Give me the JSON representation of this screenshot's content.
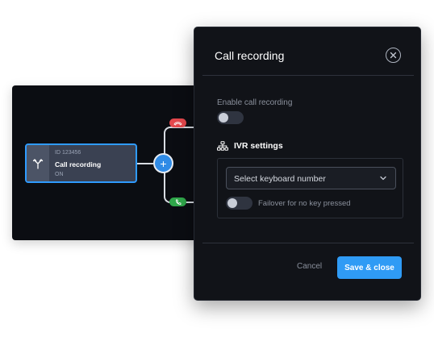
{
  "node": {
    "id_text": "ID 123456",
    "title": "Call recording",
    "status": "ON",
    "icon": "branch-split-icon"
  },
  "connectors": {
    "add_symbol": "+",
    "top_pill_icon": "hangup-phone-icon",
    "top_pill_color": "#e5484d",
    "bottom_pill_icon": "phone-icon",
    "bottom_pill_color": "#30a84b"
  },
  "modal": {
    "title": "Call recording",
    "enable_label": "Enable call recording",
    "enable_on": false,
    "ivr": {
      "heading": "IVR  settings",
      "icon": "sitemap-icon",
      "select_placeholder": "Select  keyboard number",
      "failover_label": "Failover for no key pressed",
      "failover_on": false
    },
    "cancel_label": "Cancel",
    "save_label": "Save & close"
  },
  "colors": {
    "accent": "#2f9bf5",
    "node_border": "#2f9bff",
    "canvas_bg": "#0b0d12",
    "modal_bg": "#111318"
  }
}
